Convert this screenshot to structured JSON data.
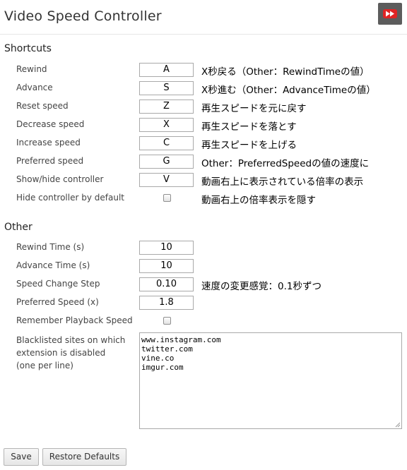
{
  "header": {
    "title": "Video Speed Controller",
    "logo_icon": "fast-forward-icon"
  },
  "shortcuts": {
    "heading": "Shortcuts",
    "rows": [
      {
        "label": "Rewind",
        "key": "A",
        "desc": "X秒戻る（Other：RewindTimeの値）"
      },
      {
        "label": "Advance",
        "key": "S",
        "desc": "X秒進む（Other：AdvanceTimeの値）"
      },
      {
        "label": "Reset speed",
        "key": "Z",
        "desc": "再生スピードを元に戻す"
      },
      {
        "label": "Decrease speed",
        "key": "X",
        "desc": "再生スピードを落とす"
      },
      {
        "label": "Increase speed",
        "key": "C",
        "desc": "再生スピードを上げる"
      },
      {
        "label": "Preferred speed",
        "key": "G",
        "desc": "Other：PreferredSpeedの値の速度に"
      },
      {
        "label": "Show/hide controller",
        "key": "V",
        "desc": "動画右上に表示されている倍率の表示"
      }
    ],
    "hide_default": {
      "label": "Hide controller by default",
      "checked": false,
      "desc": "動画右上の倍率表示を隠す"
    }
  },
  "other": {
    "heading": "Other",
    "rewind_time": {
      "label": "Rewind Time (s)",
      "value": "10"
    },
    "advance_time": {
      "label": "Advance Time (s)",
      "value": "10"
    },
    "speed_step": {
      "label": "Speed Change Step",
      "value": "0.10",
      "desc": "速度の変更感覚：0.1秒ずつ"
    },
    "preferred_speed": {
      "label": "Preferred Speed (x)",
      "value": "1.8"
    },
    "remember_speed": {
      "label": "Remember Playback Speed",
      "checked": false
    },
    "blacklist": {
      "label_lines": [
        "Blacklisted sites on which",
        "extension is disabled",
        "(one per line)"
      ],
      "lines": [
        "www.instagram.com",
        "twitter.com",
        "vine.co",
        "imgur.com"
      ]
    }
  },
  "buttons": {
    "save": "Save",
    "restore": "Restore Defaults"
  }
}
